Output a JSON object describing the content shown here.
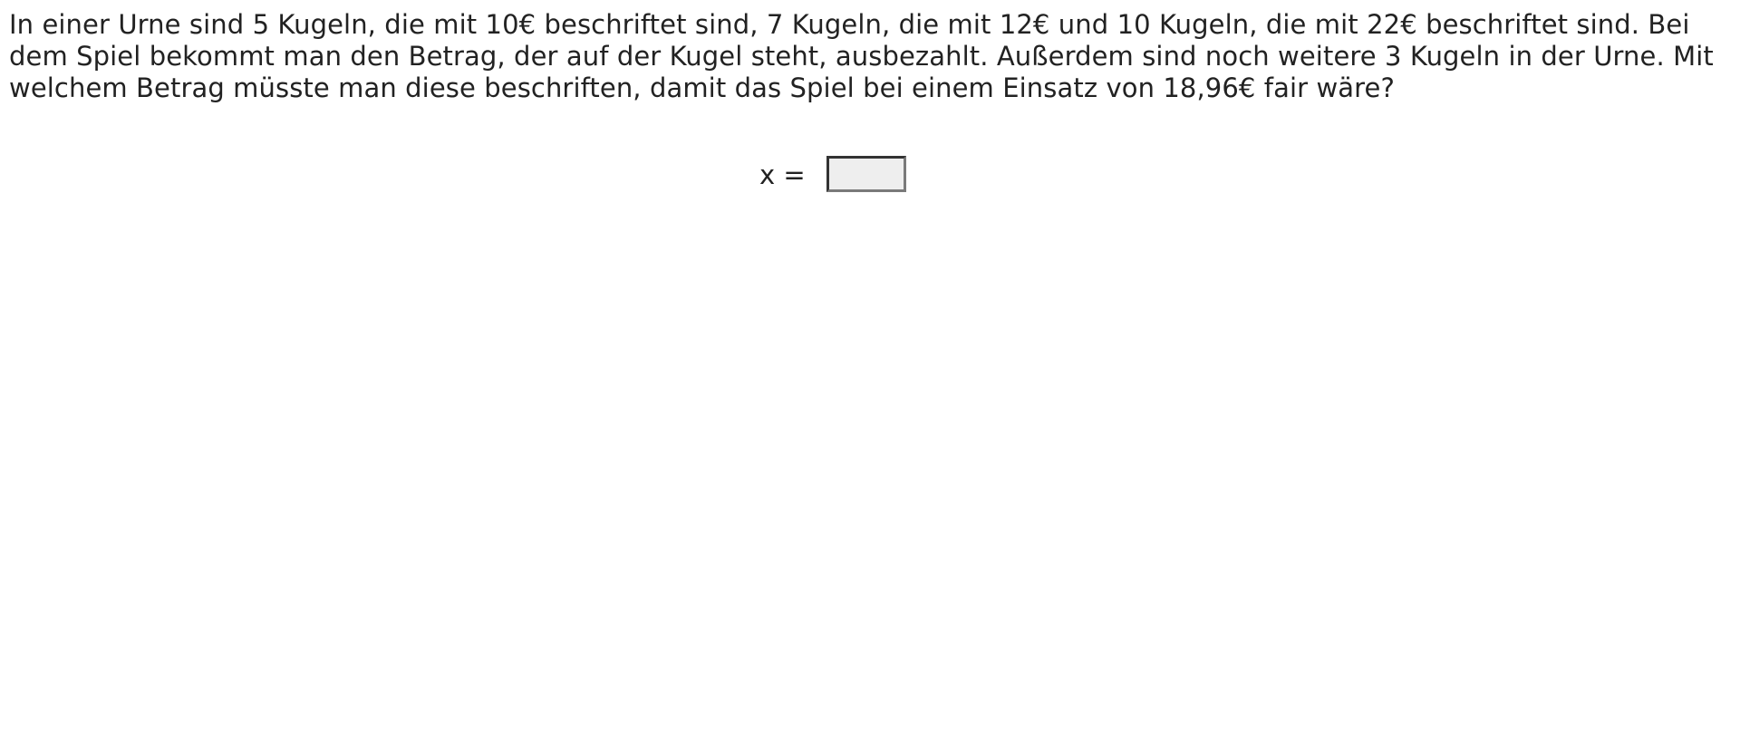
{
  "exercise": {
    "question": "In einer Urne sind 5 Kugeln, die mit 10€ beschriftet sind, 7 Kugeln, die mit 12€ und 10 Kugeln, die mit 22€ beschriftet sind. Bei dem Spiel bekommt man den Betrag, der auf der Kugel steht, ausbezahlt. Außerdem sind noch weitere 3 Kugeln in der Urne. Mit welchem Betrag müsste man diese beschriften, damit das Spiel bei einem Einsatz von 18,96€ fair wäre?",
    "answer": {
      "label": "x =",
      "value": ""
    }
  }
}
